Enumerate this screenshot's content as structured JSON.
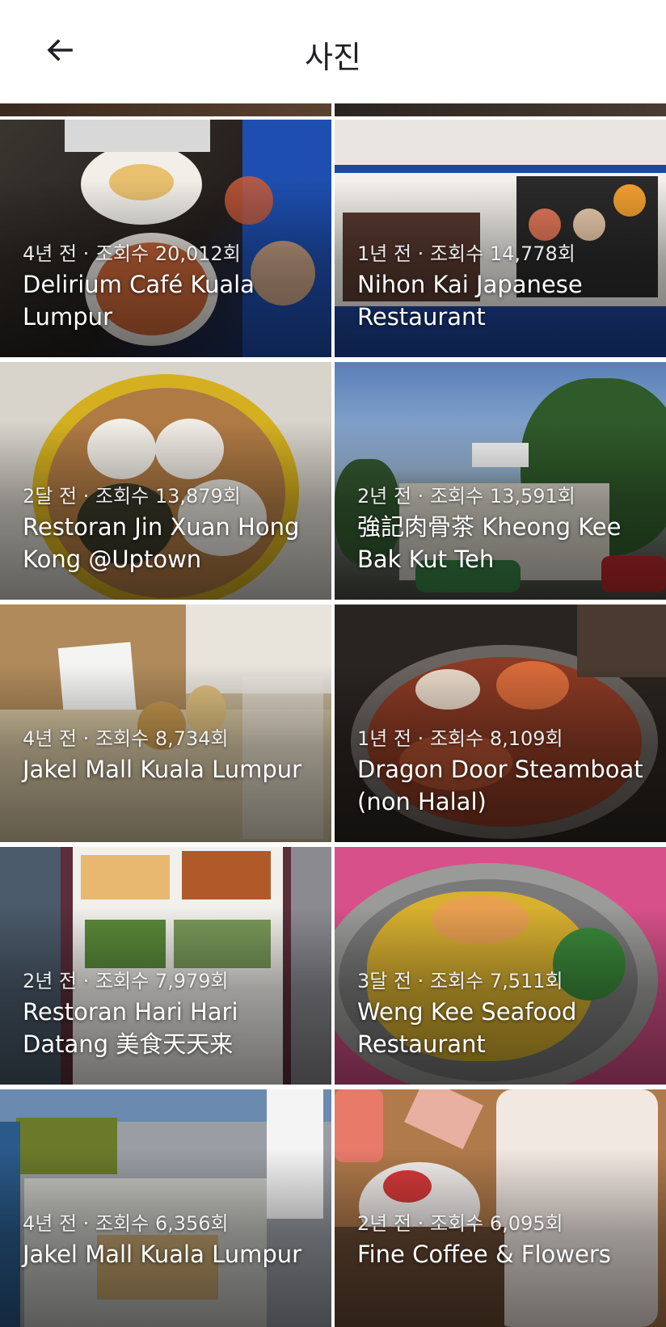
{
  "header": {
    "title": "사진",
    "back_icon": "arrow-back-icon"
  },
  "places": [
    {
      "meta": "4년 전 · 조회수 20,012회",
      "name": "Delirium Café Kuala Lumpur",
      "bg": "#2c2520"
    },
    {
      "meta": "1년 전 · 조회수 14,778회",
      "name": "Nihon Kai Japanese Restaurant",
      "bg": "#1f3f7a"
    },
    {
      "meta": "2달 전 · 조회수 13,879회",
      "name": "Restoran Jin Xuan Hong Kong @Uptown",
      "bg": "#6b5a3c"
    },
    {
      "meta": "2년 전 · 조회수 13,591회",
      "name": "強記肉骨茶 Kheong Kee Bak Kut Teh",
      "bg": "#4f6f8a"
    },
    {
      "meta": "4년 전 · 조회수 8,734회",
      "name": "Jakel Mall Kuala Lumpur",
      "bg": "#8a7a5e"
    },
    {
      "meta": "1년 전 · 조회수 8,109회",
      "name": "Dragon Door Steamboat (non Halal)",
      "bg": "#3a2a20"
    },
    {
      "meta": "2년 전 · 조회수 7,979회",
      "name": "Restoran Hari Hari Datang 美食天天来",
      "bg": "#5a4a44"
    },
    {
      "meta": "3달 전 · 조회수 7,511회",
      "name": "Weng Kee Seafood Restaurant",
      "bg": "#b0507a"
    },
    {
      "meta": "4년 전 · 조회수 6,356회",
      "name": "Jakel Mall Kuala Lumpur",
      "bg": "#6a6a6a"
    },
    {
      "meta": "2년 전 · 조회수 6,095회",
      "name": "Fine Coffee & Flowers",
      "bg": "#a0704a"
    }
  ]
}
